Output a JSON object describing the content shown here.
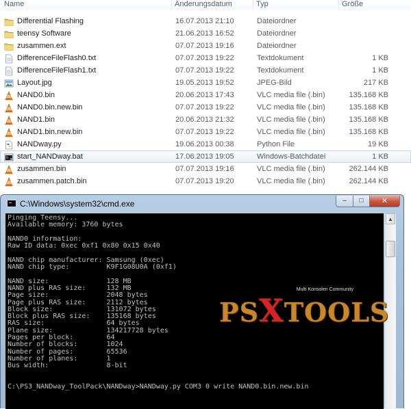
{
  "explorer": {
    "columns": {
      "name": "Name",
      "date": "Änderungsdatum",
      "type": "Typ",
      "size": "Größe"
    },
    "files": [
      {
        "icon": "folder-icon",
        "name": "Differential Flashing",
        "date": "16.07.2013 21:10",
        "type": "Dateiordner",
        "size": ""
      },
      {
        "icon": "folder-icon",
        "name": "teensy Software",
        "date": "21.06.2013 16:52",
        "type": "Dateiordner",
        "size": ""
      },
      {
        "icon": "folder-icon",
        "name": "zusammen.ext",
        "date": "07.07.2013 19:16",
        "type": "Dateiordner",
        "size": ""
      },
      {
        "icon": "text-file-icon",
        "name": "DifferenceFileFlash0.txt",
        "date": "07.07.2013 19:22",
        "type": "Textdokument",
        "size": "1 KB"
      },
      {
        "icon": "text-file-icon",
        "name": "DifferenceFileFlash1.txt",
        "date": "07.07.2013 19:22",
        "type": "Textdokument",
        "size": "1 KB"
      },
      {
        "icon": "image-file-icon",
        "name": "Layout.jpg",
        "date": "19.05.2013 19:52",
        "type": "JPEG-Bild",
        "size": "217 KB"
      },
      {
        "icon": "vlc-cone-icon",
        "name": "NAND0.bin",
        "date": "20.06.2013 17:43",
        "type": "VLC media file (.bin)",
        "size": "135.168 KB"
      },
      {
        "icon": "vlc-cone-icon",
        "name": "NAND0.bin.new.bin",
        "date": "07.07.2013 19:22",
        "type": "VLC media file (.bin)",
        "size": "135.168 KB"
      },
      {
        "icon": "vlc-cone-icon",
        "name": "NAND1.bin",
        "date": "20.06.2013 21:32",
        "type": "VLC media file (.bin)",
        "size": "135.168 KB"
      },
      {
        "icon": "vlc-cone-icon",
        "name": "NAND1.bin.new.bin",
        "date": "07.07.2013 19:22",
        "type": "VLC media file (.bin)",
        "size": "135.168 KB"
      },
      {
        "icon": "python-file-icon",
        "name": "NANDway.py",
        "date": "19.06.2013 00:38",
        "type": "Python File",
        "size": "19 KB"
      },
      {
        "icon": "batch-file-icon",
        "name": "start_NANDway.bat",
        "date": "17.06.2013 19:05",
        "type": "Windows-Batchdatei",
        "size": "1 KB",
        "selected": true
      },
      {
        "icon": "vlc-cone-icon",
        "name": "zusammen.bin",
        "date": "07.07.2013 19:16",
        "type": "VLC media file (.bin)",
        "size": "262.144 KB"
      },
      {
        "icon": "vlc-cone-icon",
        "name": "zusammen.patch.bin",
        "date": "07.07.2013 19:20",
        "type": "VLC media file (.bin)",
        "size": "262.144 KB"
      }
    ]
  },
  "cmd": {
    "title": "C:\\Windows\\system32\\cmd.exe",
    "buttons": {
      "minimize": "–",
      "maximize": "□",
      "close": "✕"
    },
    "lines": [
      "Pinging Teensy...",
      "Available memory: 3760 bytes",
      "",
      "NAND0 information:",
      "Raw ID data: 0xec 0xf1 0x80 0x15 0x40",
      "",
      "NAND chip manufacturer: Samsung (0xec)",
      "NAND chip type:         K9F1G08U0A (0xf1)",
      "",
      "NAND size:              128 MB",
      "NAND plus RAS size:     132 MB",
      "Page size:              2048 bytes",
      "Page plus RAS size:     2112 bytes",
      "Block size:             131072 bytes",
      "Block plus RAS size:    135168 bytes",
      "RAS size:               64 bytes",
      "Plane size:             134217728 bytes",
      "Pages per block:        64",
      "Number of blocks:       1024",
      "Number of pages:        65536",
      "Number of planes:       1",
      "Bus width:              8-bit",
      "",
      "",
      "C:\\PS3_NANDway_ToolPack\\NANDway>NANDway.py COM3 0 write NAND0.bin.new.bin"
    ],
    "colors": {
      "background": "#000000",
      "text": "#c0c0c0"
    }
  },
  "watermark": {
    "tagline": "Multi Konsolen Community",
    "text_before": "PS",
    "text_x": "X",
    "text_after": "TOOLS"
  }
}
